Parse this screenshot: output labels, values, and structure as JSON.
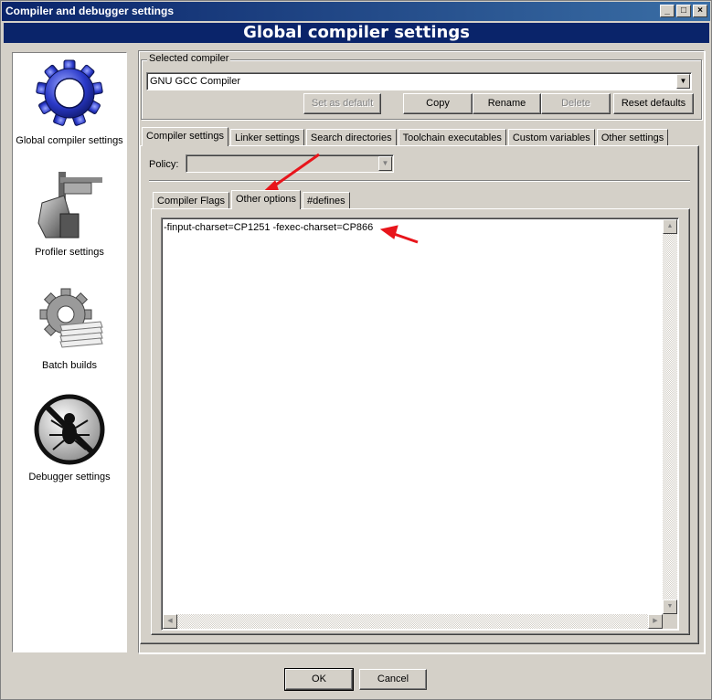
{
  "window": {
    "title": "Compiler and debugger settings",
    "banner": "Global compiler settings",
    "min": "_",
    "max": "□",
    "close": "×"
  },
  "sidebar": {
    "items": [
      {
        "label": "Global compiler settings",
        "icon": "gear-icon"
      },
      {
        "label": "Profiler settings",
        "icon": "caliper-icon"
      },
      {
        "label": "Batch builds",
        "icon": "gear-stack-icon"
      },
      {
        "label": "Debugger settings",
        "icon": "no-bug-icon"
      }
    ]
  },
  "compiler": {
    "group_label": "Selected compiler",
    "selected": "GNU GCC Compiler",
    "buttons": {
      "set_default": "Set as default",
      "copy": "Copy",
      "rename": "Rename",
      "delete": "Delete",
      "reset": "Reset defaults"
    }
  },
  "tabs": [
    "Compiler settings",
    "Linker settings",
    "Search directories",
    "Toolchain executables",
    "Custom variables",
    "Other settings"
  ],
  "policy": {
    "label": "Policy:",
    "value": ""
  },
  "subtabs": [
    "Compiler Flags",
    "Other options",
    "#defines"
  ],
  "editor": {
    "text": "-finput-charset=CP1251 -fexec-charset=CP866"
  },
  "footer": {
    "ok": "OK",
    "cancel": "Cancel"
  },
  "colors": {
    "titlebar": "#0a246a",
    "annotation_arrow": "#e8151b"
  }
}
